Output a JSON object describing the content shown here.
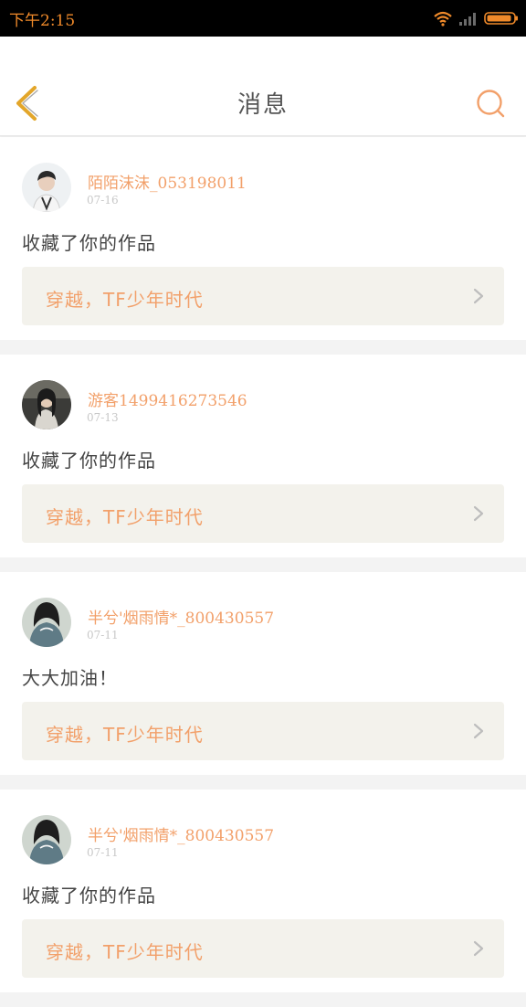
{
  "status_bar": {
    "time": "下午2:15",
    "accent": "#f08a2a"
  },
  "header": {
    "title": "消息",
    "back_icon": "chevron-left-icon",
    "search_icon": "search-icon"
  },
  "colors": {
    "accent": "#f2a06a",
    "back_arrow": "#e3a62a",
    "card_link_bg": "#f3f2ec"
  },
  "messages": [
    {
      "user": "陌陌沫沫_053198011",
      "date": "07-16",
      "text": "收藏了你的作品",
      "work": "穿越，TF少年时代",
      "avatar": "avatar-boy-icon"
    },
    {
      "user": "游客1499416273546",
      "date": "07-13",
      "text": "收藏了你的作品",
      "work": "穿越，TF少年时代",
      "avatar": "avatar-girl-icon"
    },
    {
      "user": "半兮'烟雨情*_800430557",
      "date": "07-11",
      "text": "大大加油！",
      "work": "穿越，TF少年时代",
      "avatar": "avatar-hoodie-icon"
    },
    {
      "user": "半兮'烟雨情*_800430557",
      "date": "07-11",
      "text": "收藏了你的作品",
      "work": "穿越，TF少年时代",
      "avatar": "avatar-hoodie-icon"
    }
  ]
}
